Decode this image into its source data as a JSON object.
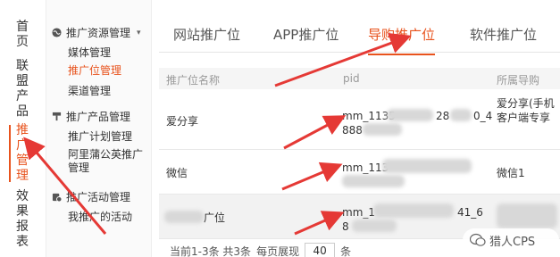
{
  "left_nav": [
    {
      "label": "首页"
    },
    {
      "label": "联盟产品"
    },
    {
      "label": "推广管理"
    },
    {
      "label": "效果报表"
    }
  ],
  "sub_nav": {
    "group1": {
      "title": "推广资源管理",
      "items": [
        "媒体管理",
        "推广位管理",
        "渠道管理"
      ]
    },
    "group2": {
      "title": "推广产品管理",
      "items": [
        "推广计划管理",
        "阿里蒲公英推广管理"
      ]
    },
    "group3": {
      "title": "推广活动管理",
      "items": [
        "我推广的活动"
      ]
    }
  },
  "tabs": [
    "网站推广位",
    "APP推广位",
    "导购推广位",
    "软件推广位"
  ],
  "table": {
    "headers": [
      "推广位名称",
      "pid",
      "所属导购"
    ],
    "rows": [
      {
        "name": "爱分享",
        "pid_line1": "mm_1135",
        "pid_mid": "28",
        "pid_tail": "0_4",
        "pid_line2": "888",
        "guide": "爱分享(手机客户端专享"
      },
      {
        "name": "微信",
        "pid_line1": "mm_113",
        "pid_line2": "",
        "guide": "微信1"
      },
      {
        "name": "广位",
        "pid_line1": "mm_1",
        "pid_mid": "41_6",
        "pid_line2": "8",
        "guide": ""
      }
    ]
  },
  "footer": {
    "summary": "当前1-3条  共3条",
    "per_page_label": "每页展现",
    "per_page_value": "40",
    "unit": "条"
  },
  "watermark": "猎人CPS",
  "colors": {
    "accent": "#e8531d",
    "arrow": "#e53935"
  }
}
